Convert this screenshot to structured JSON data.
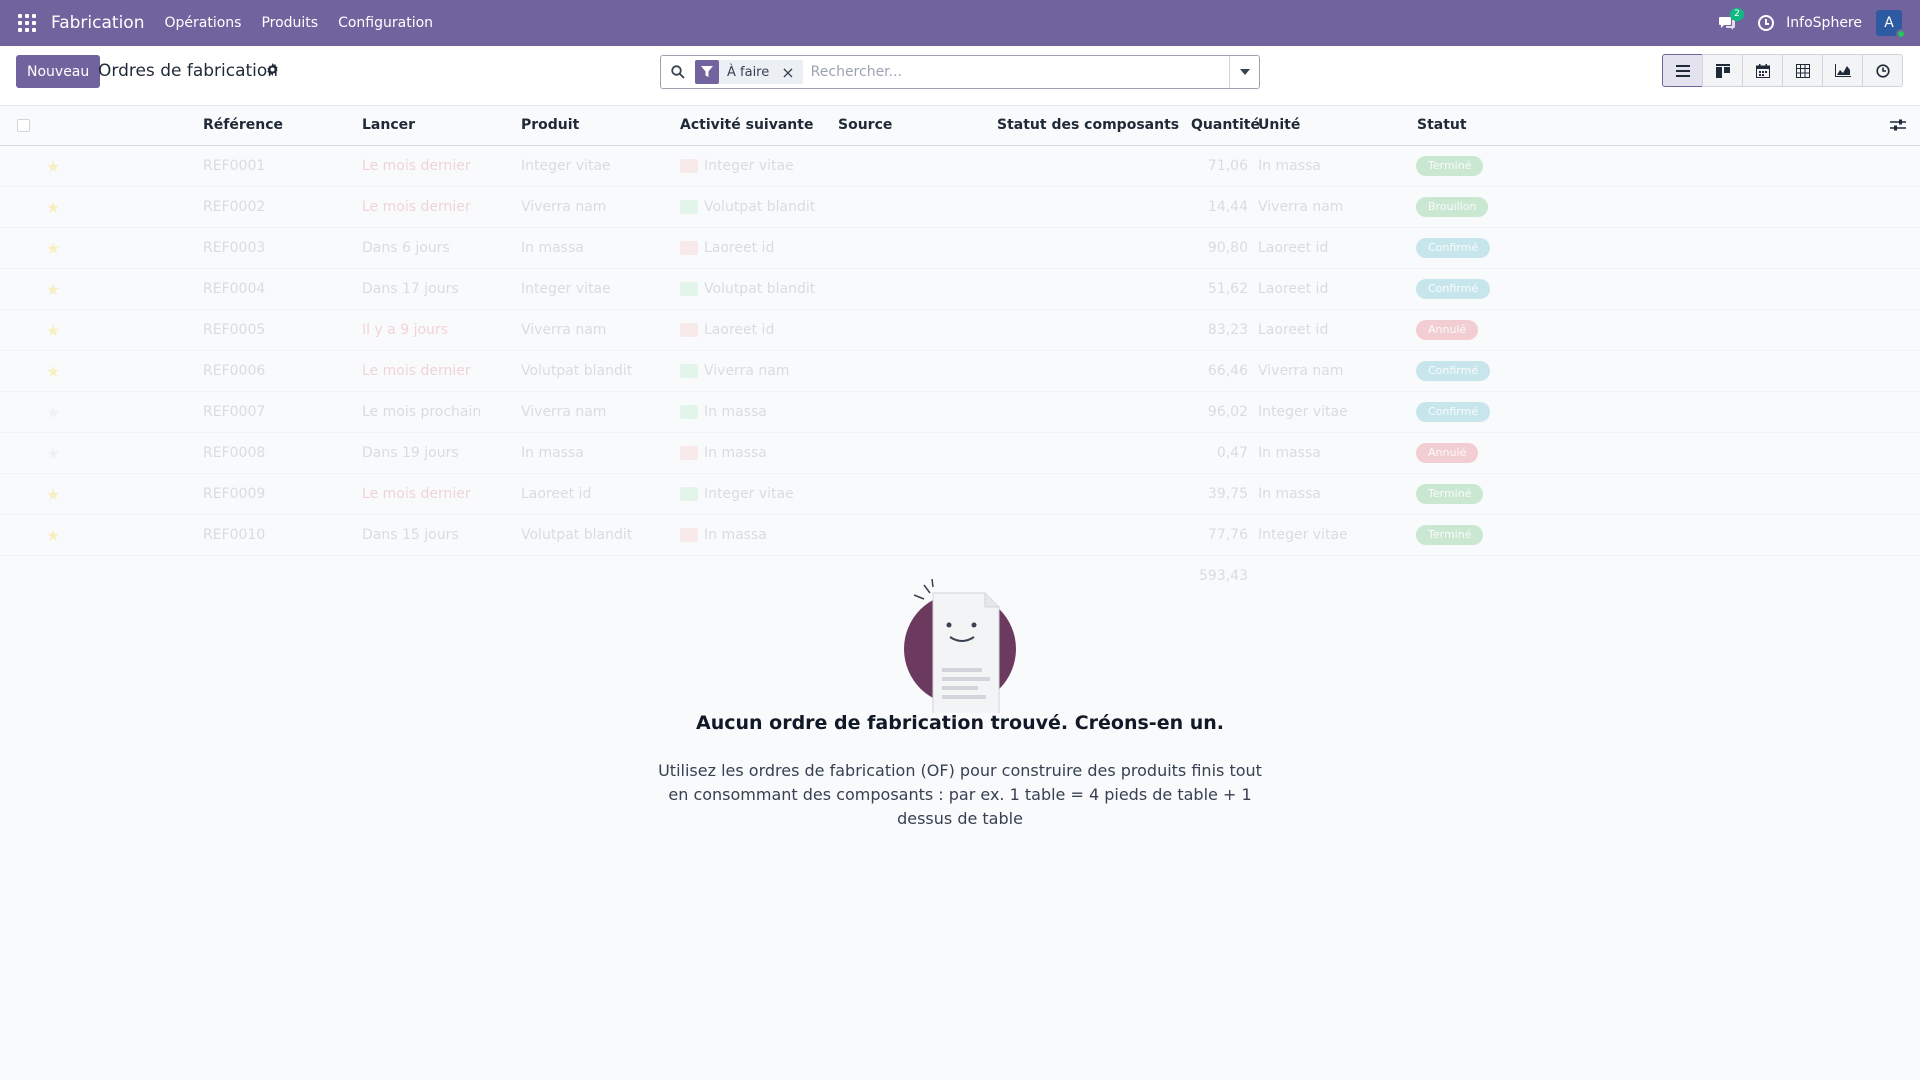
{
  "navbar": {
    "app_name": "Fabrication",
    "menus": [
      "Opérations",
      "Produits",
      "Configuration"
    ],
    "messages_badge": "2",
    "company_name": "InfoSphere",
    "avatar_letter": "A"
  },
  "control_panel": {
    "new_label": "Nouveau",
    "title": "Ordres de fabrication",
    "search": {
      "facet_value": "À faire",
      "facet_remove": "×",
      "placeholder": "Rechercher..."
    },
    "views": [
      "list-view-icon",
      "kanban-view-icon",
      "calendar-view-icon",
      "pivot-view-icon",
      "graph-view-icon",
      "activity-view-icon"
    ]
  },
  "list": {
    "columns": [
      "Référence",
      "Lancer",
      "Produit",
      "Activité suivante",
      "Source",
      "Statut des composants",
      "Quantité",
      "Unité",
      "Statut"
    ],
    "rows": [
      {
        "ref": "REF0001",
        "lancer": "Le mois dernier",
        "lancer_red": true,
        "produit": "Integer vitae",
        "activite": "Integer vitae",
        "act_color": "#f8b4b4",
        "quantite": "71,06",
        "unite": "In massa",
        "statut": "Terminé",
        "statut_color": "#28a745",
        "starred": true
      },
      {
        "ref": "REF0002",
        "lancer": "Le mois dernier",
        "lancer_red": true,
        "produit": "Viverra nam",
        "activite": "Volutpat blandit",
        "act_color": "#9ae6b4",
        "quantite": "14,44",
        "unite": "Viverra nam",
        "statut": "Brouillon",
        "statut_color": "#28a745",
        "starred": true
      },
      {
        "ref": "REF0003",
        "lancer": "Dans 6 jours",
        "lancer_red": false,
        "produit": "In massa",
        "activite": "Laoreet id",
        "act_color": "#f8b4b4",
        "quantite": "90,80",
        "unite": "Laoreet id",
        "statut": "Confirmé",
        "statut_color": "#17a2b8",
        "starred": true
      },
      {
        "ref": "REF0004",
        "lancer": "Dans 17 jours",
        "lancer_red": false,
        "produit": "Integer vitae",
        "activite": "Volutpat blandit",
        "act_color": "#9ae6b4",
        "quantite": "51,62",
        "unite": "Laoreet id",
        "statut": "Confirmé",
        "statut_color": "#17a2b8",
        "starred": true
      },
      {
        "ref": "REF0005",
        "lancer": "Il y a 9 jours",
        "lancer_red": true,
        "produit": "Viverra nam",
        "activite": "Laoreet id",
        "act_color": "#f8b4b4",
        "quantite": "83,23",
        "unite": "Laoreet id",
        "statut": "Annulé",
        "statut_color": "#dc3545",
        "starred": true
      },
      {
        "ref": "REF0006",
        "lancer": "Le mois dernier",
        "lancer_red": true,
        "produit": "Volutpat blandit",
        "activite": "Viverra nam",
        "act_color": "#9ae6b4",
        "quantite": "66,46",
        "unite": "Viverra nam",
        "statut": "Confirmé",
        "statut_color": "#17a2b8",
        "starred": true
      },
      {
        "ref": "REF0007",
        "lancer": "Le mois prochain",
        "lancer_red": false,
        "produit": "Viverra nam",
        "activite": "In massa",
        "act_color": "#9ae6b4",
        "quantite": "96,02",
        "unite": "Integer vitae",
        "statut": "Confirmé",
        "statut_color": "#17a2b8",
        "starred": false
      },
      {
        "ref": "REF0008",
        "lancer": "Dans 19 jours",
        "lancer_red": false,
        "produit": "In massa",
        "activite": "In massa",
        "act_color": "#f8b4b4",
        "quantite": "0,47",
        "unite": "In massa",
        "statut": "Annulé",
        "statut_color": "#dc3545",
        "starred": false
      },
      {
        "ref": "REF0009",
        "lancer": "Le mois dernier",
        "lancer_red": true,
        "produit": "Laoreet id",
        "activite": "Integer vitae",
        "act_color": "#9ae6b4",
        "quantite": "39,75",
        "unite": "In massa",
        "statut": "Terminé",
        "statut_color": "#28a745",
        "starred": true
      },
      {
        "ref": "REF0010",
        "lancer": "Dans 15 jours",
        "lancer_red": false,
        "produit": "Volutpat blandit",
        "activite": "In massa",
        "act_color": "#f8b4b4",
        "quantite": "77,76",
        "unite": "Integer vitae",
        "statut": "Terminé",
        "statut_color": "#28a745",
        "starred": true
      }
    ],
    "total_quantite": "593,43"
  },
  "helper": {
    "title": "Aucun ordre de fabrication trouvé. Créons-en un.",
    "text": "Utilisez les ordres de fabrication (OF) pour construire des produits finis tout en consommant des composants : par ex. 1 table = 4 pieds de table + 1 dessus de table"
  },
  "colors": {
    "brand": "#71639e",
    "illustration_circle": "#6b3a5e"
  }
}
